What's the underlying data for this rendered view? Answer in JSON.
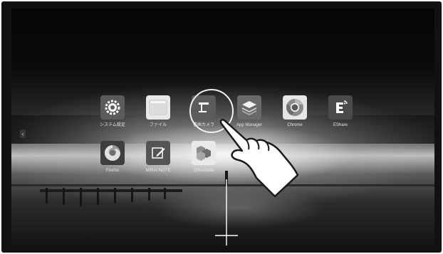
{
  "apps": [
    {
      "key": "settings",
      "label": "システム設定",
      "icon": "gear-icon"
    },
    {
      "key": "files",
      "label": "ファイル",
      "icon": "folder-icon"
    },
    {
      "key": "whiteboard",
      "label": "書画カメラ",
      "icon": "document-camera-icon"
    },
    {
      "key": "app-manager",
      "label": "App Manager",
      "icon": "layers-icon"
    },
    {
      "key": "chrome",
      "label": "Chrome",
      "icon": "chrome-icon"
    },
    {
      "key": "eshare",
      "label": "EShare",
      "icon": "eshare-icon"
    },
    {
      "key": "firefox",
      "label": "Firefox",
      "icon": "firefox-icon"
    },
    {
      "key": "mirai-note",
      "label": "MIRAI NOTE",
      "icon": "note-pen-icon"
    },
    {
      "key": "officesuite",
      "label": "OfficeSuite",
      "icon": "officesuite-icon"
    }
  ],
  "nav": {
    "left_arrow": "‹",
    "right_arrow": "‹"
  },
  "colors": {
    "tile": "#5b5b5b",
    "label": "#e8e8e8",
    "ring": "#f2f2f2"
  }
}
